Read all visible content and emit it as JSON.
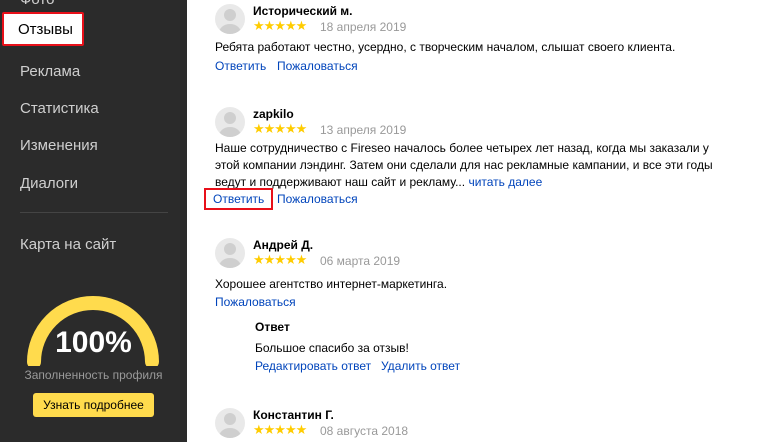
{
  "sidebar": {
    "top_cut_label": "Фото",
    "active_item": "Отзывы",
    "items": [
      {
        "label": "Реклама"
      },
      {
        "label": "Статистика"
      },
      {
        "label": "Изменения"
      },
      {
        "label": "Диалоги"
      }
    ],
    "map_item": "Карта на сайт",
    "profile": {
      "percent_label": "100%",
      "percent_value": 100,
      "caption": "Заполненность профиля",
      "more_button": "Узнать подробнее",
      "gauge_color": "#ffdb4d"
    }
  },
  "reviews": [
    {
      "author": "Исторический м.",
      "stars": "★★★★★",
      "rating": 5,
      "date": "18 апреля 2019",
      "text": "Ребята работают честно, усердно, с творческим началом, слышат своего клиента.",
      "reply": "Ответить",
      "complain": "Пожаловаться"
    },
    {
      "author": "zapkilo",
      "stars": "★★★★★",
      "rating": 5,
      "date": "13 апреля 2019",
      "text_line1": "Наше сотрудничество с Fireseo началось более четырех лет назад, когда мы заказали у",
      "text_line2": "этой компании лэндинг. Затем они сделали для нас рекламные кампании, и все эти годы",
      "text_line3": "ведут и поддерживают наш сайт и рекламу...",
      "read_more": "читать далее",
      "reply": "Ответить",
      "complain": "Пожаловаться"
    },
    {
      "author": "Андрей Д.",
      "stars": "★★★★★",
      "rating": 5,
      "date": "06 марта 2019",
      "text": "Хорошее агентство интернет-маркетинга.",
      "complain": "Пожаловаться",
      "answer": {
        "title": "Ответ",
        "text": "Большое спасибо за отзыв!",
        "edit": "Редактировать ответ",
        "delete": "Удалить ответ"
      }
    },
    {
      "author": "Константин Г.",
      "stars": "★★★★★",
      "rating": 5,
      "date": "08 августа 2018"
    }
  ],
  "colors": {
    "sidebar_bg": "#2b2b2b",
    "highlight": "#e8101a",
    "link": "#0044bb",
    "star": "#ffcc00",
    "accent": "#ffdb4d"
  }
}
